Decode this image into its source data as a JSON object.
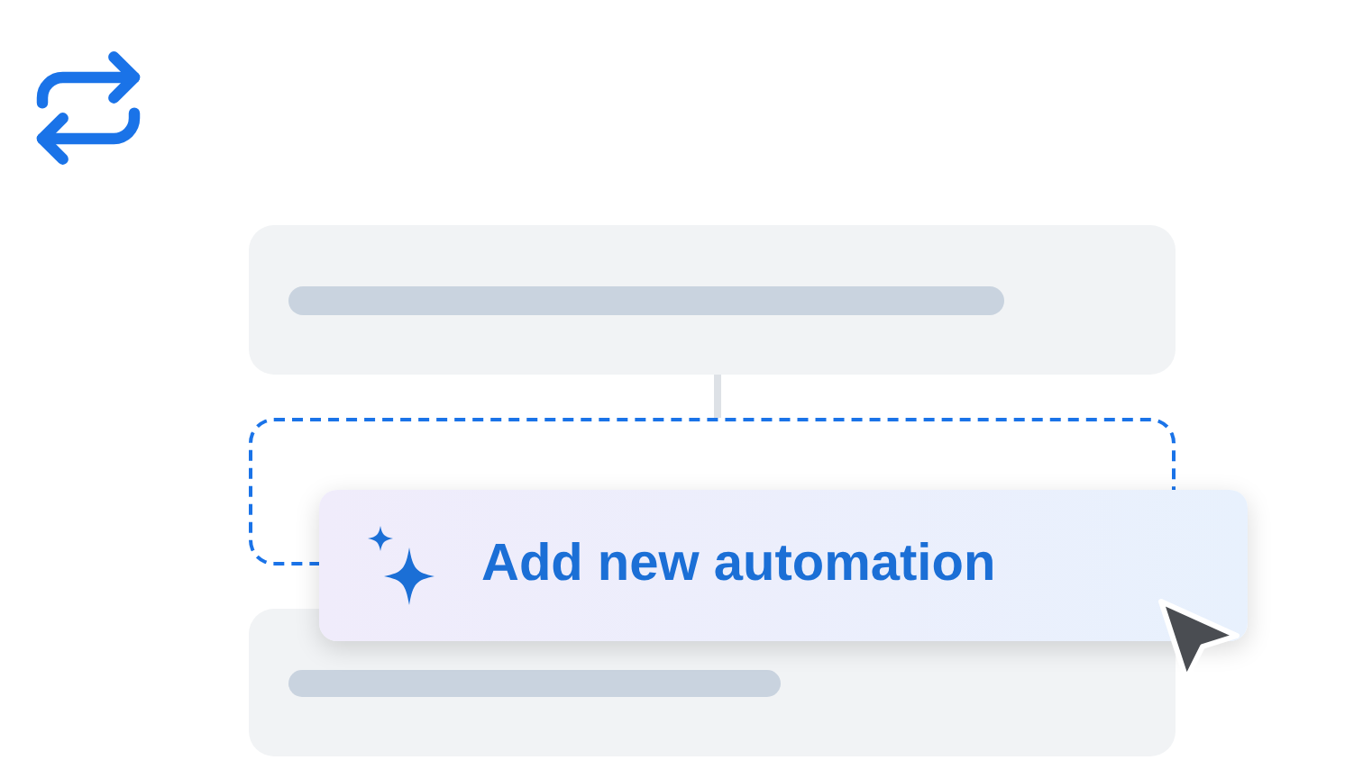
{
  "button": {
    "label": "Add new automation"
  }
}
